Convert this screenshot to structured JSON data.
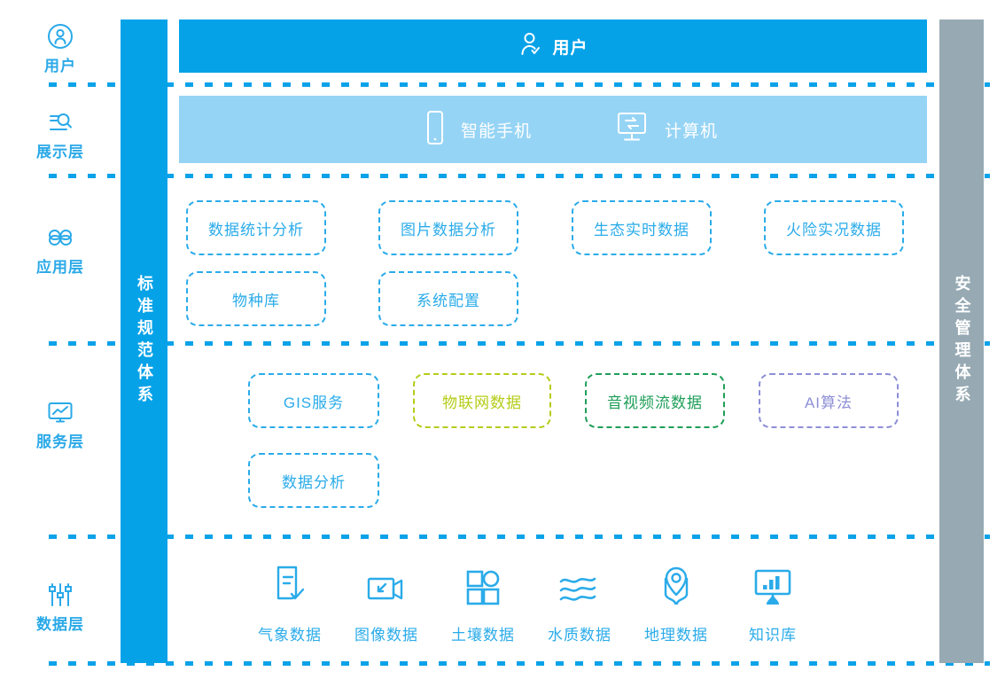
{
  "colors": {
    "primary_blue": "#05a2e8",
    "light_blue": "#96d4f5",
    "text_blue": "#2aabe9",
    "gray": "#97aab4",
    "yellow_green": "#b5cc18",
    "green": "#1e9e58",
    "purple": "#8d8fd6"
  },
  "side_bars": {
    "standards": "标准规范体系",
    "security": "安全管理体系"
  },
  "layer_labels": [
    {
      "icon": "user-circle-icon",
      "name": "用户"
    },
    {
      "icon": "search-list-icon",
      "name": "展示层"
    },
    {
      "icon": "apps-grid-icon",
      "name": "应用层"
    },
    {
      "icon": "monitor-chart-icon",
      "name": "服务层"
    },
    {
      "icon": "sliders-icon",
      "name": "数据层"
    }
  ],
  "user_band": {
    "icon": "user-check-icon",
    "label": "用户"
  },
  "presentation": {
    "items": [
      {
        "icon": "smartphone-icon",
        "label": "智能手机"
      },
      {
        "icon": "desktop-exchange-icon",
        "label": "计算机"
      }
    ]
  },
  "application": {
    "row1": [
      "数据统计分析",
      "图片数据分析",
      "生态实时数据",
      "火险实况数据"
    ],
    "row2": [
      "物种库",
      "系统配置"
    ]
  },
  "service": {
    "row1": [
      {
        "label": "GIS服务",
        "color": "#2aabe9"
      },
      {
        "label": "物联网数据",
        "color": "#b5cc18"
      },
      {
        "label": "音视频流数据",
        "color": "#1e9e58"
      },
      {
        "label": "AI算法",
        "color": "#8d8fd6"
      }
    ],
    "row2": [
      {
        "label": "数据分析",
        "color": "#2aabe9"
      }
    ]
  },
  "data_layer": {
    "items": [
      {
        "icon": "document-check-icon",
        "label": "气象数据"
      },
      {
        "icon": "video-camera-icon",
        "label": "图像数据"
      },
      {
        "icon": "four-squares-icon",
        "label": "土壤数据"
      },
      {
        "icon": "water-waves-icon",
        "label": "水质数据"
      },
      {
        "icon": "map-pin-icon",
        "label": "地理数据"
      },
      {
        "icon": "monitor-bars-icon",
        "label": "知识库"
      }
    ]
  }
}
